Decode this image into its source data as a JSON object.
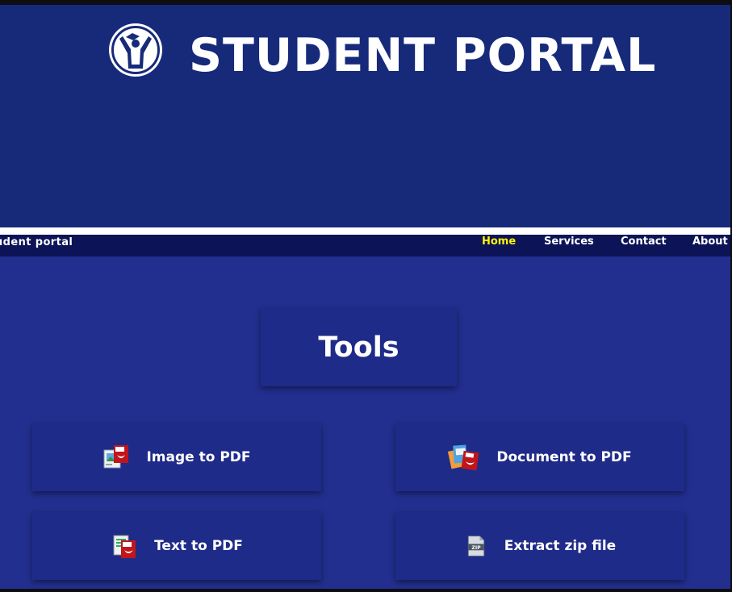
{
  "header": {
    "title": "STUDENT PORTAL",
    "logo_icon": "graduate-icon"
  },
  "nav": {
    "brand": "udent portal",
    "items": [
      {
        "label": "Home",
        "active": true
      },
      {
        "label": "Services",
        "active": false
      },
      {
        "label": "Contact",
        "active": false
      },
      {
        "label": "About",
        "active": false
      }
    ]
  },
  "main": {
    "heading": "Tools",
    "tools": [
      {
        "label": "Image to PDF",
        "icon": "image-to-pdf-icon"
      },
      {
        "label": "Document to PDF",
        "icon": "document-to-pdf-icon"
      },
      {
        "label": "Text to PDF",
        "icon": "text-to-pdf-icon"
      },
      {
        "label": "Extract zip file",
        "icon": "zip-file-icon"
      }
    ]
  },
  "colors": {
    "header_bg": "#172a7a",
    "navbar_bg": "#0c1457",
    "content_bg": "#222f8f",
    "card_bg": "#1f2b88",
    "active_nav": "#fff200",
    "text": "#ffffff"
  }
}
